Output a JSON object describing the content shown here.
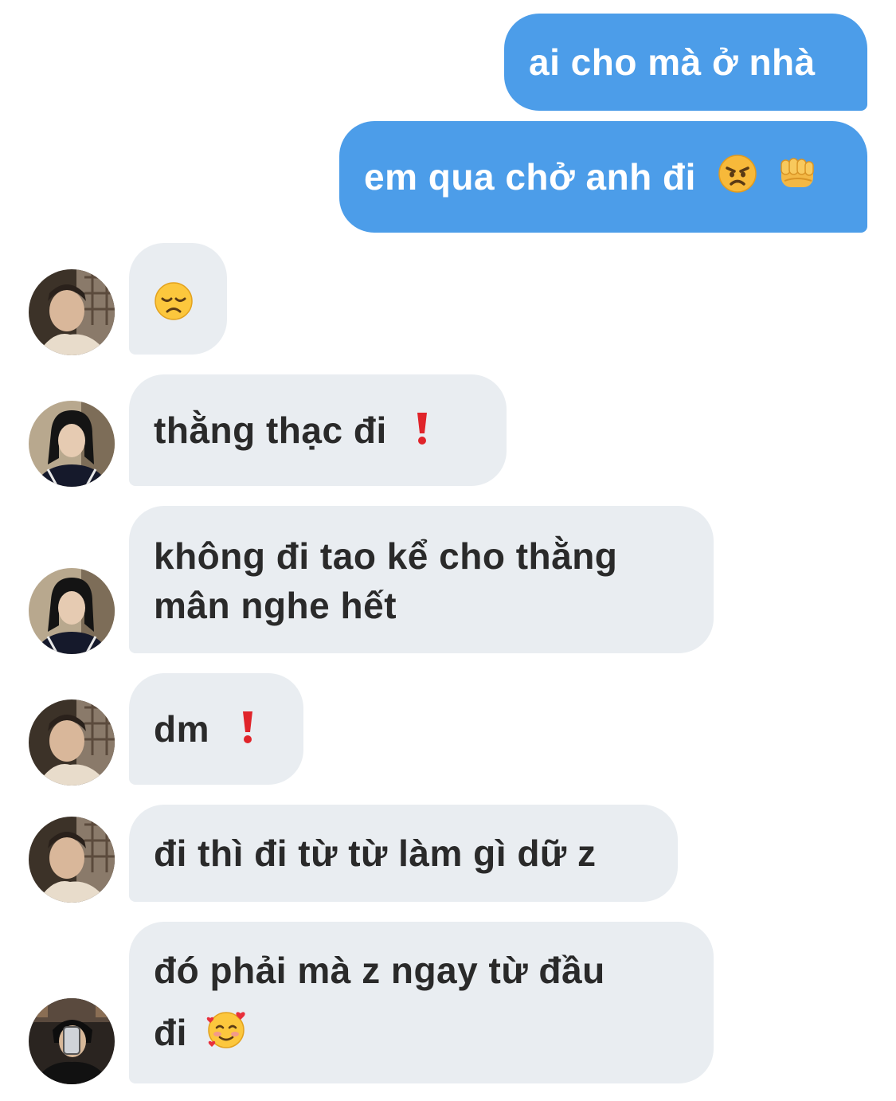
{
  "messages": [
    {
      "id": "m1",
      "side": "sent",
      "text": "ai cho mà ở nhà"
    },
    {
      "id": "m2",
      "side": "sent",
      "text": "em qua chở anh đi",
      "emojis": [
        "angry-face-icon",
        "fist-bump-icon"
      ]
    },
    {
      "id": "m3",
      "side": "received",
      "avatar": "avatar-a",
      "text": "",
      "emojis": [
        "disappointed-face-icon"
      ]
    },
    {
      "id": "m4",
      "side": "received",
      "avatar": "avatar-b",
      "text": "thằng thạc đi",
      "emojis": [
        "red-exclamation-icon"
      ]
    },
    {
      "id": "m5",
      "side": "received",
      "avatar": "avatar-b",
      "lines": [
        "không đi tao kể cho thằng",
        "mân nghe hết"
      ]
    },
    {
      "id": "m6",
      "side": "received",
      "avatar": "avatar-a",
      "text": "dm",
      "emojis": [
        "red-exclamation-icon"
      ]
    },
    {
      "id": "m7",
      "side": "received",
      "avatar": "avatar-a",
      "text": "đi thì đi từ từ làm gì dữ z"
    },
    {
      "id": "m8",
      "side": "received",
      "avatar": "avatar-c",
      "lines": [
        "đó phải mà z ngay từ đầu",
        "đi"
      ],
      "emojis": [
        "smiling-face-with-hearts-icon"
      ]
    }
  ],
  "colors": {
    "sent_bubble": "#4c9de9",
    "received_bubble": "#e9edf1",
    "sent_text": "#ffffff",
    "received_text": "#2a2a2a"
  }
}
